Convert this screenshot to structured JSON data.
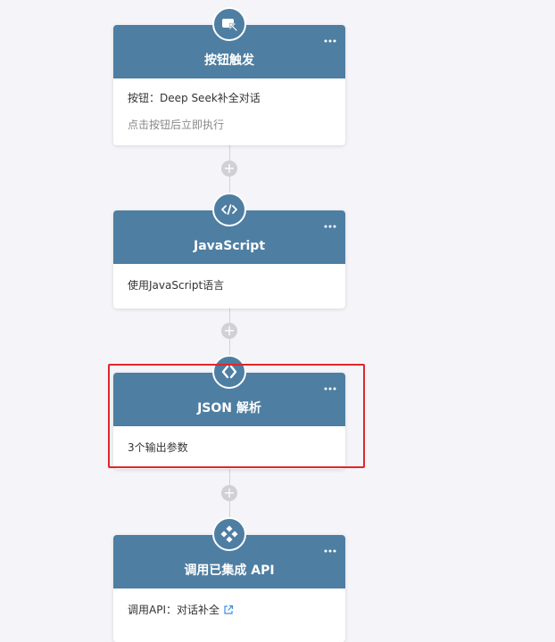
{
  "nodes": [
    {
      "icon": "button-trigger-icon",
      "title": "按钮触发",
      "line1": "按钮：Deep Seek补全对话",
      "line2": "点击按钮后立即执行"
    },
    {
      "icon": "code-icon",
      "title": "JavaScript",
      "line1": "使用JavaScript语言"
    },
    {
      "icon": "json-parse-icon",
      "title": "JSON 解析",
      "line1": "3个输出参数"
    },
    {
      "icon": "api-integration-icon",
      "title": "调用已集成 API",
      "line1": "调用API：对话补全"
    }
  ],
  "add_button_symbol": "+",
  "more_menu_icon": "more-horizontal-icon",
  "external_link_icon": "external-link-icon",
  "colors": {
    "header": "#4e7ea2",
    "highlight": "#e0262a",
    "connector": "#d2d2d8",
    "add_button": "#d0d0d6",
    "background": "#f4f4f9"
  }
}
